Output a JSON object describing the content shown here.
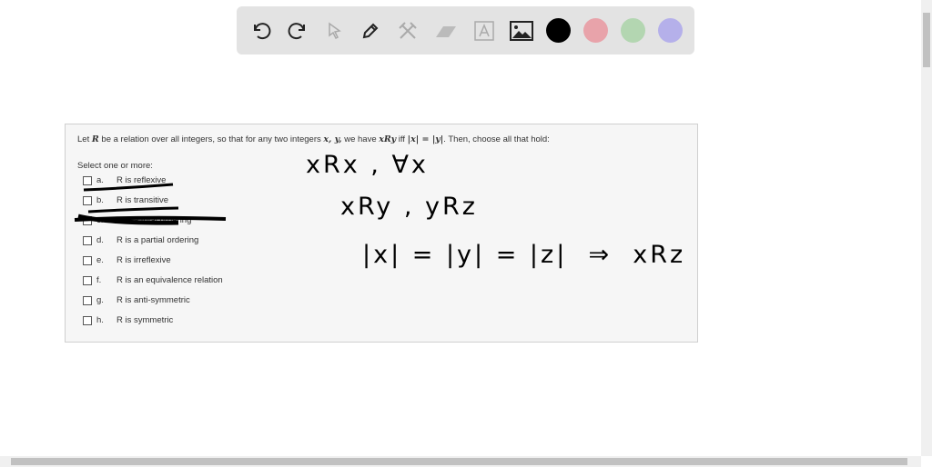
{
  "toolbar": {
    "tools": [
      "undo-icon",
      "redo-icon",
      "pointer-icon",
      "pen-icon",
      "tools-icon",
      "eraser-icon",
      "text-icon",
      "image-icon"
    ],
    "colors": [
      "#000000",
      "#e8a3aa",
      "#b3d6b1",
      "#b5b0ea"
    ]
  },
  "question": {
    "text_pre": "Let ",
    "R": "R",
    "text_mid": " be a relation over all integers, so that for any two integers ",
    "xy": "x, y,",
    "text_mid2": " we have ",
    "xRy": "xRy",
    "text_iff": " iff ",
    "abs": "|x| = |y|",
    "text_end": ". Then, choose all that hold:",
    "select_label": "Select one or more:",
    "options": [
      {
        "letter": "a.",
        "label": "R is reflexive"
      },
      {
        "letter": "b.",
        "label": "R is transitive"
      },
      {
        "letter": "c.",
        "label": "R is a total ordering"
      },
      {
        "letter": "d.",
        "label": "R is a partial ordering"
      },
      {
        "letter": "e.",
        "label": "R is irreflexive"
      },
      {
        "letter": "f.",
        "label": "R is an equivalence relation"
      },
      {
        "letter": "g.",
        "label": "R is anti-symmetric"
      },
      {
        "letter": "h.",
        "label": "R is symmetric"
      }
    ]
  },
  "handwriting": [
    "xRx , ∀x",
    "xRy , yRz",
    "|x| = |y| = |z|  ⇒  xRz"
  ]
}
